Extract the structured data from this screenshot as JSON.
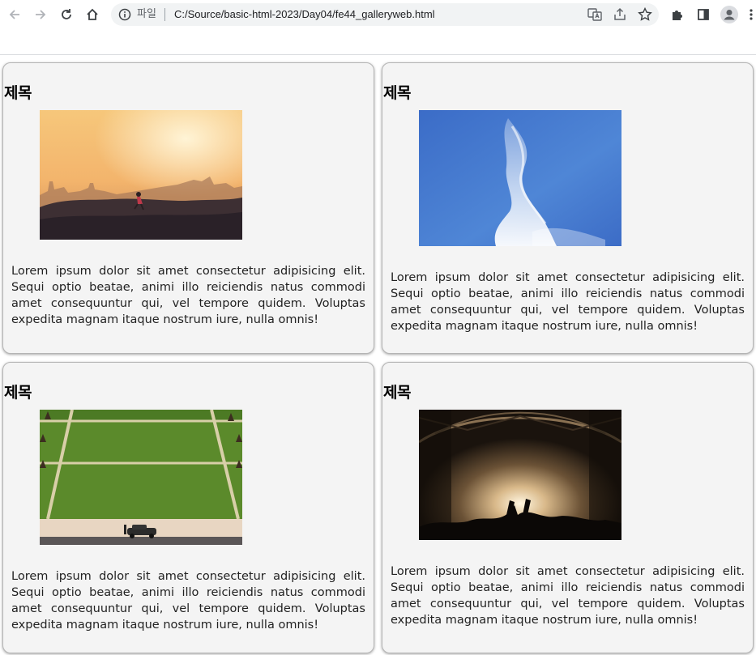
{
  "browser": {
    "scheme_label": "파일",
    "url": "C:/Source/basic-html-2023/Day04/fe44_galleryweb.html"
  },
  "cards": [
    {
      "title": "제목",
      "image": "sunset-city-runner",
      "text": "Lorem ipsum dolor sit amet consectetur adipisicing elit. Sequi optio beatae, animi illo reiciendis natus commodi amet consequuntur qui, vel tempore quidem. Voluptas expedita magnam itaque nostrum iure, nulla omnis!"
    },
    {
      "title": "제목",
      "image": "blue-sky-cloud",
      "text": "Lorem ipsum dolor sit amet consectetur adipisicing elit. Sequi optio beatae, animi illo reiciendis natus commodi amet consequuntur qui, vel tempore quidem. Voluptas expedita magnam itaque nostrum iure, nulla omnis!"
    },
    {
      "title": "제목",
      "image": "green-lawn-car",
      "text": "Lorem ipsum dolor sit amet consectetur adipisicing elit. Sequi optio beatae, animi illo reiciendis natus commodi amet consequuntur qui, vel tempore quidem. Voluptas expedita magnam itaque nostrum iure, nulla omnis!"
    },
    {
      "title": "제목",
      "image": "concert-stage-lights",
      "text": "Lorem ipsum dolor sit amet consectetur adipisicing elit. Sequi optio beatae, animi illo reiciendis natus commodi amet consequuntur qui, vel tempore quidem. Voluptas expedita magnam itaque nostrum iure, nulla omnis!"
    }
  ],
  "icons": {
    "back": "arrow-left-icon",
    "forward": "arrow-right-icon",
    "reload": "reload-icon",
    "home": "home-icon",
    "info": "info-icon",
    "translate": "translate-icon",
    "share": "share-icon",
    "bookmark": "star-icon",
    "extensions": "puzzle-icon",
    "side_panel": "side-panel-icon",
    "profile": "profile-icon",
    "menu": "kebab-menu-icon"
  }
}
